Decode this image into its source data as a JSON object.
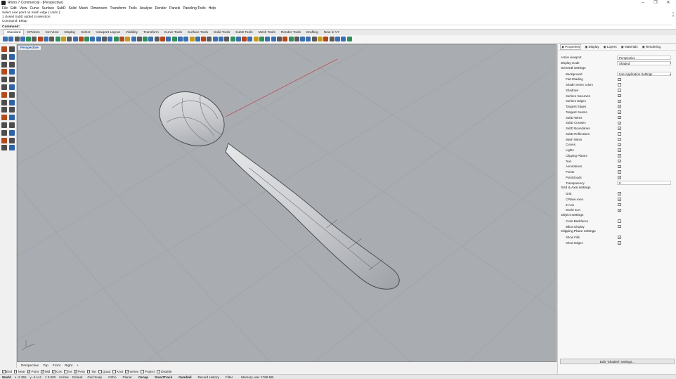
{
  "window": {
    "title": "Rhino 7 Commercial - [Perspective]",
    "controls": [
      "–",
      "❐",
      "✕"
    ]
  },
  "menu": [
    "File",
    "Edit",
    "View",
    "Curve",
    "Surface",
    "SubD",
    "Solid",
    "Mesh",
    "Dimension",
    "Transform",
    "Tools",
    "Analyze",
    "Render",
    "Panels",
    "Paneling Tools",
    "Help"
  ],
  "command_history": [
    "Select next point on mesh edge ( Undo ):",
    "1 closed SubD added to selection.",
    "Command: EMap"
  ],
  "command_prompt": "Command:",
  "toolbar_tabs": [
    "Standard",
    "CPlanes",
    "Set View",
    "Display",
    "Select",
    "Viewport Layout",
    "Visibility",
    "Transform",
    "Curve Tools",
    "Surface Tools",
    "Solid Tools",
    "SubD Tools",
    "Mesh Tools",
    "Render Tools",
    "Drafting",
    "New in V7"
  ],
  "toolbar_icon_count_note": "",
  "viewport": {
    "label": "Perspective",
    "background": "#a8acb0"
  },
  "viewport_tabs": [
    "Perspective",
    "Top",
    "Front",
    "Right",
    "+"
  ],
  "osnaps": [
    {
      "label": "End",
      "checked": true
    },
    {
      "label": "Near",
      "checked": false
    },
    {
      "label": "Point",
      "checked": true
    },
    {
      "label": "Mid",
      "checked": true
    },
    {
      "label": "Cen",
      "checked": true
    },
    {
      "label": "Int",
      "checked": false
    },
    {
      "label": "Perp",
      "checked": true
    },
    {
      "label": "Tan",
      "checked": false
    },
    {
      "label": "Quad",
      "checked": false
    },
    {
      "label": "Knot",
      "checked": false
    },
    {
      "label": "Vertex",
      "checked": true
    },
    {
      "label": "Project",
      "checked": false
    },
    {
      "label": "Disable",
      "checked": false
    }
  ],
  "status": {
    "cplane": "World",
    "x": "x -2.355",
    "y": "y -4.141",
    "z": "z 0.000",
    "units": "Inches",
    "layer": "Default",
    "panes": [
      {
        "label": "Grid Snap",
        "on": false
      },
      {
        "label": "Ortho",
        "on": false
      },
      {
        "label": "Planar",
        "on": false
      },
      {
        "label": "Osnap",
        "on": true
      },
      {
        "label": "SmartTrack",
        "on": true
      },
      {
        "label": "Gumball",
        "on": true
      },
      {
        "label": "Record History",
        "on": false
      },
      {
        "label": "Filter",
        "on": false
      }
    ],
    "memory": "Memory use: 1768 MB"
  },
  "panel": {
    "tabs": [
      "Properties",
      "Display",
      "Layers",
      "Materials",
      "Rendering"
    ],
    "active_viewport_label": "Active viewport",
    "active_viewport_value": "Perspective",
    "display_mode_label": "Display mode",
    "display_mode_value": "Shaded",
    "general_heading": "General settings",
    "background_label": "Background",
    "background_value": "Use Application Settings",
    "general_items": [
      {
        "label": "Flat Shading",
        "checked": false
      },
      {
        "label": "Shade vertex colors",
        "checked": false
      },
      {
        "label": "Shadows",
        "checked": false
      },
      {
        "label": "Surface Isocurves",
        "checked": true
      },
      {
        "label": "Surface Edges",
        "checked": true
      },
      {
        "label": "Tangent Edges",
        "checked": true
      },
      {
        "label": "Tangent Seams",
        "checked": true
      },
      {
        "label": "SubD Wires",
        "checked": true
      },
      {
        "label": "SubD Creases",
        "checked": true
      },
      {
        "label": "SubD Boundaries",
        "checked": true
      },
      {
        "label": "SubD Reflections",
        "checked": false
      },
      {
        "label": "Mesh Wires",
        "checked": false
      },
      {
        "label": "Curves",
        "checked": true
      },
      {
        "label": "Lights",
        "checked": true
      },
      {
        "label": "Clipping Planes",
        "checked": true
      },
      {
        "label": "Text",
        "checked": true
      },
      {
        "label": "Annotations",
        "checked": true
      },
      {
        "label": "Points",
        "checked": true
      },
      {
        "label": "Pointclouds",
        "checked": true
      }
    ],
    "transparency_label": "Transparency",
    "transparency_value": "0",
    "grid_heading": "Grid & Axis settings",
    "grid_items": [
      {
        "label": "Grid",
        "checked": true
      },
      {
        "label": "CPlane Axes",
        "checked": true
      },
      {
        "label": "Z Axis",
        "checked": false
      },
      {
        "label": "World Icon",
        "checked": true
      }
    ],
    "object_heading": "Object settings",
    "object_items": [
      {
        "label": "Color Backfaces",
        "checked": false
      },
      {
        "label": "Blbox Display",
        "checked": false
      }
    ],
    "clip_heading": "Clipping Plane settings",
    "clip_items": [
      {
        "label": "Show Fills",
        "checked": true
      },
      {
        "label": "Show Edges",
        "checked": true
      }
    ],
    "edit_button": "Edit \"Shaded\" settings..."
  }
}
